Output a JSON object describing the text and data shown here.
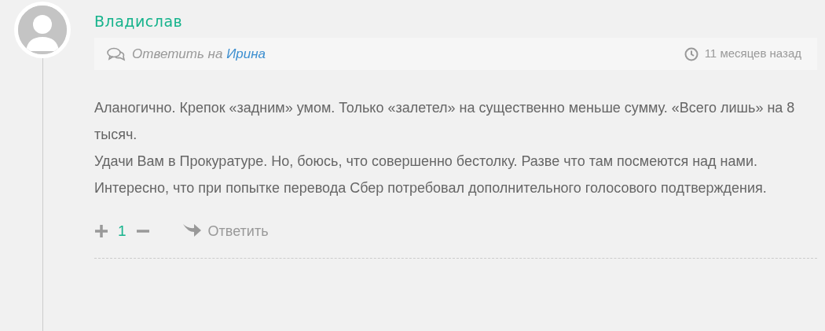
{
  "author": {
    "name": "Владислав"
  },
  "reply_to": {
    "prefix": "Ответить на",
    "target": "Ирина"
  },
  "time": "11 месяцев назад",
  "paragraphs": [
    "Аланогично. Крепок «задним» умом. Только «залетел» на существенно меньше сумму. «Всего лишь» на 8 тысяч.",
    "Удачи Вам в Прокуратуре. Но, боюсь, что совершенно бестолку. Разве что там посмеются над нами.",
    "Интересно, что при попытке перевода Сбер потребовал дополнительного голосового подтверждения."
  ],
  "votes": {
    "count": "1"
  },
  "reply_button": "Ответить"
}
